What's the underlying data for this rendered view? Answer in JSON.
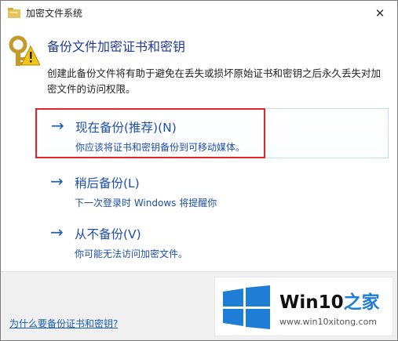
{
  "window": {
    "title": "加密文件系统",
    "close_glyph": "✕"
  },
  "header": {
    "title": "备份文件加密证书和密钥",
    "description": "创建此备份文件将有助于避免在丢失或损坏原始证书和密钥之后永久丢失对加密文件的访问权限。"
  },
  "options": [
    {
      "arrow": "→",
      "title": "现在备份(推荐)(N)",
      "subtitle": "你应该将证书和密钥备份到可移动媒体。",
      "icon": "arrow-right-icon"
    },
    {
      "arrow": "→",
      "title": "稍后备份(L)",
      "subtitle": "下一次登录时 Windows 将提醒你",
      "icon": "arrow-right-icon"
    },
    {
      "arrow": "→",
      "title": "从不备份(V)",
      "subtitle": "你可能无法访问加密文件。",
      "icon": "arrow-right-icon"
    }
  ],
  "footer": {
    "help_link": "为什么要备份证书和密钥?"
  },
  "watermark": {
    "brand_prefix": "Win10",
    "brand_suffix": "之家",
    "url": "www.win10xitong.com"
  },
  "colors": {
    "accent": "#1e5fb4",
    "highlight_border": "#e0252b",
    "win_blue": "#1e7ed6"
  }
}
